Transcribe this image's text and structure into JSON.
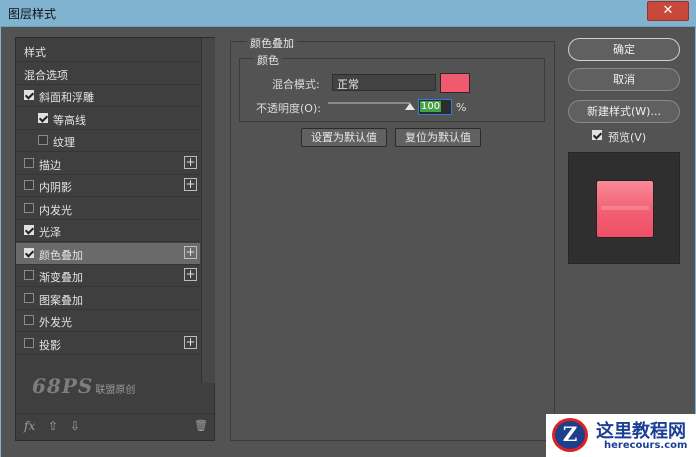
{
  "window": {
    "title": "图层样式",
    "close_glyph": "✕"
  },
  "styles_panel": {
    "items": [
      {
        "label": "样式",
        "checkbox": false,
        "checked": false,
        "plus": false,
        "indent": 0,
        "selected": false
      },
      {
        "label": "混合选项",
        "checkbox": false,
        "checked": false,
        "plus": false,
        "indent": 0,
        "selected": false
      },
      {
        "label": "斜面和浮雕",
        "checkbox": true,
        "checked": true,
        "plus": false,
        "indent": 0,
        "selected": false
      },
      {
        "label": "等高线",
        "checkbox": true,
        "checked": true,
        "plus": false,
        "indent": 1,
        "selected": false
      },
      {
        "label": "纹理",
        "checkbox": true,
        "checked": false,
        "plus": false,
        "indent": 1,
        "selected": false
      },
      {
        "label": "描边",
        "checkbox": true,
        "checked": false,
        "plus": true,
        "indent": 0,
        "selected": false
      },
      {
        "label": "内阴影",
        "checkbox": true,
        "checked": false,
        "plus": true,
        "indent": 0,
        "selected": false
      },
      {
        "label": "内发光",
        "checkbox": true,
        "checked": false,
        "plus": false,
        "indent": 0,
        "selected": false
      },
      {
        "label": "光泽",
        "checkbox": true,
        "checked": true,
        "plus": false,
        "indent": 0,
        "selected": false
      },
      {
        "label": "颜色叠加",
        "checkbox": true,
        "checked": true,
        "plus": true,
        "indent": 0,
        "selected": true
      },
      {
        "label": "渐变叠加",
        "checkbox": true,
        "checked": false,
        "plus": true,
        "indent": 0,
        "selected": false
      },
      {
        "label": "图案叠加",
        "checkbox": true,
        "checked": false,
        "plus": false,
        "indent": 0,
        "selected": false
      },
      {
        "label": "外发光",
        "checkbox": true,
        "checked": false,
        "plus": false,
        "indent": 0,
        "selected": false
      },
      {
        "label": "投影",
        "checkbox": true,
        "checked": false,
        "plus": true,
        "indent": 0,
        "selected": false
      }
    ],
    "watermark_big": "68PS",
    "watermark_small": "联盟原创",
    "fx_label": "fx",
    "up_glyph": "⇧",
    "down_glyph": "⇩",
    "trash_glyph": "🗑"
  },
  "color_overlay": {
    "group_title": "颜色叠加",
    "sub_title": "颜色",
    "blend_mode_label": "混合模式:",
    "blend_mode_value": "正常",
    "overlay_color": "#f05a6e",
    "opacity_label": "不透明度(O):",
    "opacity_value": "100",
    "opacity_percent": 100,
    "opacity_unit": "%",
    "set_default_label": "设置为默认值",
    "reset_default_label": "复位为默认值"
  },
  "actions": {
    "ok_label": "确定",
    "cancel_label": "取消",
    "new_style_label": "新建样式(W)...",
    "preview_label": "预览(V)",
    "preview_checked": true
  },
  "site_badge": {
    "name": "这里教程网",
    "url": "herecours.com",
    "logo_letter": "Z"
  }
}
